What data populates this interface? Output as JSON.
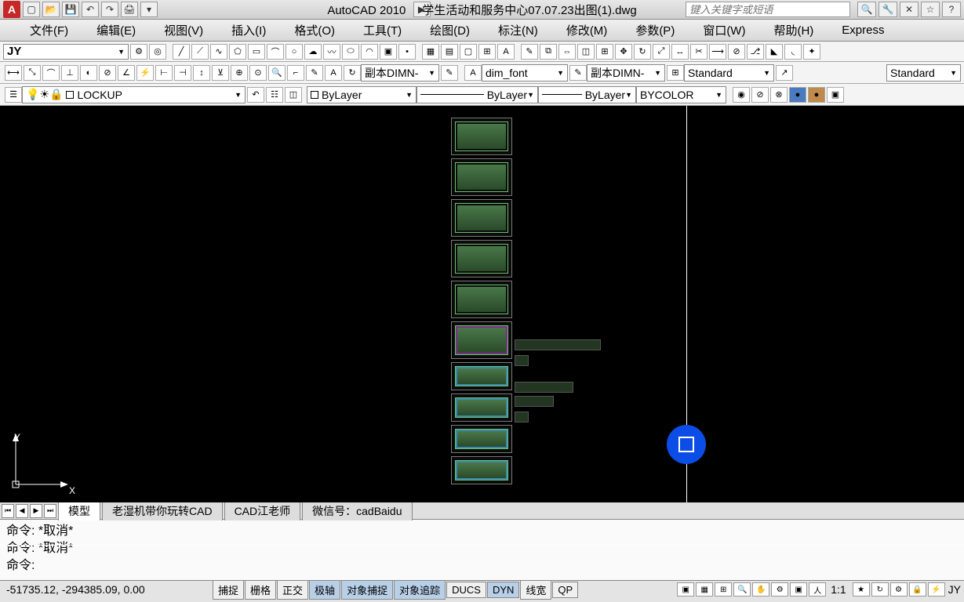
{
  "title": {
    "app": "AutoCAD 2010",
    "file": "学生活动和服务中心07.07.23出图(1).dwg",
    "search_placeholder": "键入关键字或短语"
  },
  "menu": {
    "file": "文件(F)",
    "edit": "编辑(E)",
    "view": "视图(V)",
    "insert": "插入(I)",
    "format": "格式(O)",
    "tools": "工具(T)",
    "draw": "绘图(D)",
    "dim": "标注(N)",
    "modify": "修改(M)",
    "param": "参数(P)",
    "window": "窗口(W)",
    "help": "帮助(H)",
    "express": "Express"
  },
  "tb1": {
    "jy": "JY"
  },
  "tb2": {
    "dimstyle": "副本DIMN-",
    "font": "dim_font",
    "dimstyle2": "副本DIMN-",
    "std": "Standard",
    "std2": "Standard"
  },
  "tb3": {
    "layer": "LOCKUP",
    "bylayer1": "ByLayer",
    "bylayer2": "ByLayer",
    "bylayer3": "ByLayer",
    "bycolor": "BYCOLOR"
  },
  "ucs": {
    "y": "Y",
    "x": "X"
  },
  "tabs": {
    "model": "模型",
    "t1": "老湿机带你玩转CAD",
    "t2": "CAD江老师",
    "t3": "微信号：cadBaidu"
  },
  "cmd": {
    "l1": "命令: *取消*",
    "l2": "命令: *取消*",
    "l3": "命令:"
  },
  "status": {
    "coords": "-51735.12,  -294385.09, 0.00",
    "snap": "捕捉",
    "grid": "栅格",
    "ortho": "正交",
    "polar": "极轴",
    "osnap": "对象捕捉",
    "otrack": "对象追踪",
    "ducs": "DUCS",
    "dyn": "DYN",
    "lw": "线宽",
    "qp": "QP",
    "ratio": "1:1",
    "jy": "JY"
  }
}
